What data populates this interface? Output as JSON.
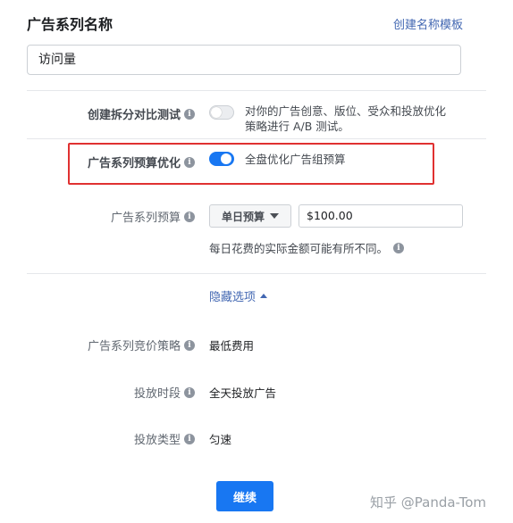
{
  "header": {
    "title": "广告系列名称",
    "template_link": "创建名称模板"
  },
  "campaign_name": {
    "value": "访问量"
  },
  "split_test": {
    "label": "创建拆分对比测试",
    "toggle_on": false,
    "desc_line1": "对你的广告创意、版位、受众和投放优化",
    "desc_line2": "策略进行 A/B 测试。"
  },
  "budget_optimization": {
    "label": "广告系列预算优化",
    "toggle_on": true,
    "desc": "全盘优化广告组预算"
  },
  "budget": {
    "label": "广告系列预算",
    "type_selected": "单日预算",
    "amount": "$100.00",
    "note": "每日花费的实际金额可能有所不同。"
  },
  "hide_options": {
    "label": "隐藏选项"
  },
  "bid_strategy": {
    "label": "广告系列竞价策略",
    "value": "最低费用"
  },
  "schedule": {
    "label": "投放时段",
    "value": "全天投放广告"
  },
  "delivery_type": {
    "label": "投放类型",
    "value": "匀速"
  },
  "continue_button": {
    "label": "继续"
  },
  "watermark": {
    "text": "知乎 @Panda-Tom"
  },
  "icons": {
    "info": "info-icon",
    "dropdown": "caret-down-icon",
    "collapse": "caret-up-icon"
  },
  "colors": {
    "accent": "#1877f2",
    "link": "#4267b2",
    "highlight_border": "#e03131"
  }
}
